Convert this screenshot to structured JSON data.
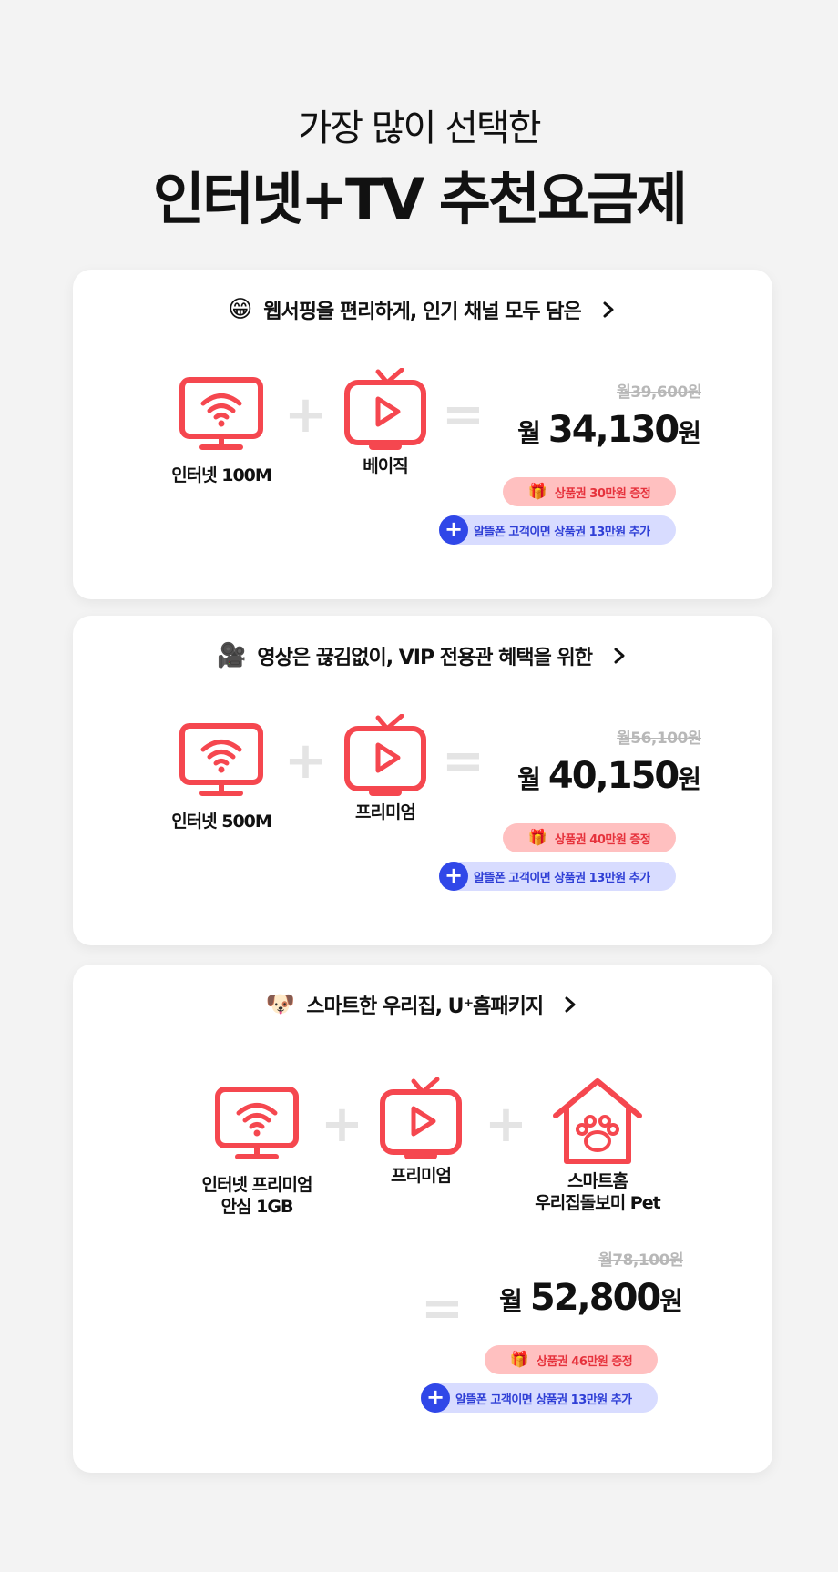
{
  "header": {
    "subtitle": "가장 많이 선택한",
    "title": "인터넷+TV 추천요금제"
  },
  "icons": {
    "internet": "monitor-wifi-icon",
    "tv": "tv-play-icon",
    "smarthome": "paw-house-icon",
    "gift": "gift-icon",
    "plus": "plus-icon",
    "chevron": "chevron-right-icon"
  },
  "colors": {
    "accent": "#f5474f",
    "gift_bg": "#ffc0c0",
    "gift_text": "#e6323c",
    "bonus_bg": "#d8dcff",
    "bonus_accent": "#3047e8"
  },
  "plans": [
    {
      "emoji": "😁",
      "headline": "웹서핑을 편리하게, 인기 채널 모두 담은",
      "items": [
        "인터넷 100M",
        "베이직"
      ],
      "original_price": "월39,600원",
      "price_prefix": "월",
      "price": "34,130",
      "price_suffix": "원",
      "gift": "상품권 30만원 증정",
      "bonus": "알뜰폰 고객이면 상품권 13만원 추가"
    },
    {
      "emoji": "🎥",
      "headline": "영상은 끊김없이, VIP 전용관 혜택을 위한",
      "items": [
        "인터넷 500M",
        "프리미엄"
      ],
      "original_price": "월56,100원",
      "price_prefix": "월",
      "price": "40,150",
      "price_suffix": "원",
      "gift": "상품권 40만원 증정",
      "bonus": "알뜰폰 고객이면 상품권 13만원 추가"
    },
    {
      "emoji": "🐶",
      "headline": "스마트한 우리집, U⁺홈패키지",
      "items": [
        "인터넷 프리미엄\n안심 1GB",
        "프리미엄",
        "스마트홈\n우리집돌보미 Pet"
      ],
      "original_price": "월78,100원",
      "price_prefix": "월",
      "price": "52,800",
      "price_suffix": "원",
      "gift": "상품권 46만원 증정",
      "bonus": "알뜰폰 고객이면 상품권 13만원 추가"
    }
  ]
}
